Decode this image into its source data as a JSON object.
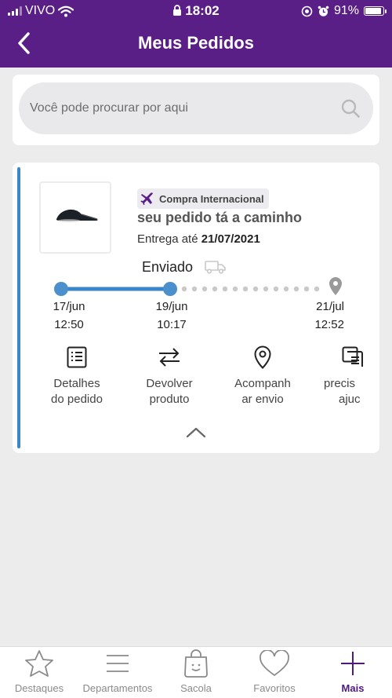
{
  "status_bar": {
    "carrier": "VIVO",
    "time": "18:02",
    "battery": "91%"
  },
  "header": {
    "title": "Meus Pedidos",
    "back_icon": "chevron-left-icon"
  },
  "search": {
    "placeholder": "Você pode procurar por aqui"
  },
  "order": {
    "badge": "Compra Internacional",
    "status": "seu pedido tá a caminho",
    "delivery_prefix": "Entrega até",
    "delivery_date": "21/07/2021",
    "progress_label": "Enviado",
    "timeline": [
      {
        "date": "17/jun",
        "time": "12:50",
        "state": "done"
      },
      {
        "date": "19/jun",
        "time": "10:17",
        "state": "current"
      },
      {
        "date": "21/jul",
        "time": "12:52",
        "state": "pending"
      }
    ],
    "actions": [
      {
        "line1": "Detalhes",
        "line2": "do pedido",
        "icon": "list-icon"
      },
      {
        "line1": "Devolver",
        "line2": "produto",
        "icon": "swap-icon"
      },
      {
        "line1": "Acompanh",
        "line2": "ar envio",
        "icon": "location-pin-icon"
      },
      {
        "line1": "precis",
        "line2": "ajuc",
        "icon": "chat-icon"
      }
    ]
  },
  "tabs": [
    {
      "label": "Destaques",
      "icon": "star-icon",
      "active": false
    },
    {
      "label": "Departamentos",
      "icon": "menu-icon",
      "active": false
    },
    {
      "label": "Sacola",
      "icon": "bag-icon",
      "active": false
    },
    {
      "label": "Favoritos",
      "icon": "heart-icon",
      "active": false
    },
    {
      "label": "Mais",
      "icon": "plus-icon",
      "active": true
    }
  ],
  "colors": {
    "brand": "#5a1e87",
    "accent": "#3b86c6"
  }
}
